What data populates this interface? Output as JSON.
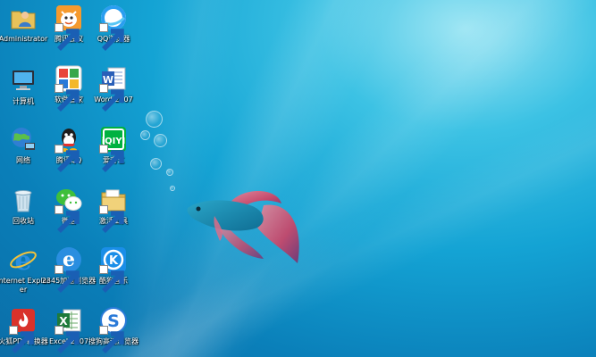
{
  "desktop": {
    "icons": [
      {
        "label": "Administrator",
        "icon": "user-folder-icon"
      },
      {
        "label": "腾讯会议",
        "icon": "tencent-meeting-icon"
      },
      {
        "label": "QQ浏览器",
        "icon": "qq-browser-icon"
      },
      {
        "label": "计算机",
        "icon": "computer-icon"
      },
      {
        "label": "软件管家",
        "icon": "software-manager-icon"
      },
      {
        "label": "Word 2007",
        "icon": "word-icon"
      },
      {
        "label": "网络",
        "icon": "network-icon"
      },
      {
        "label": "腾讯QQ",
        "icon": "qq-icon"
      },
      {
        "label": "爱奇艺",
        "icon": "iqiyi-icon"
      },
      {
        "label": "回收站",
        "icon": "recycle-bin-icon"
      },
      {
        "label": "微信",
        "icon": "wechat-icon"
      },
      {
        "label": "激活工具",
        "icon": "folder-icon"
      },
      {
        "label": "Internet Explorer",
        "icon": "internet-explorer-icon"
      },
      {
        "label": "2345加速浏览器",
        "icon": "browser-2345-icon"
      },
      {
        "label": "酷狗音乐",
        "icon": "kugou-music-icon"
      },
      {
        "label": "火狐PDF转换器",
        "icon": "pdf-converter-icon"
      },
      {
        "label": "Excel 2007",
        "icon": "excel-icon"
      },
      {
        "label": "搜狗高速浏览器",
        "icon": "sogou-browser-icon"
      }
    ]
  },
  "colors": {
    "background": "#14a3d4",
    "fish_body": "#1d8db0",
    "fish_fins": "#e0506a"
  }
}
